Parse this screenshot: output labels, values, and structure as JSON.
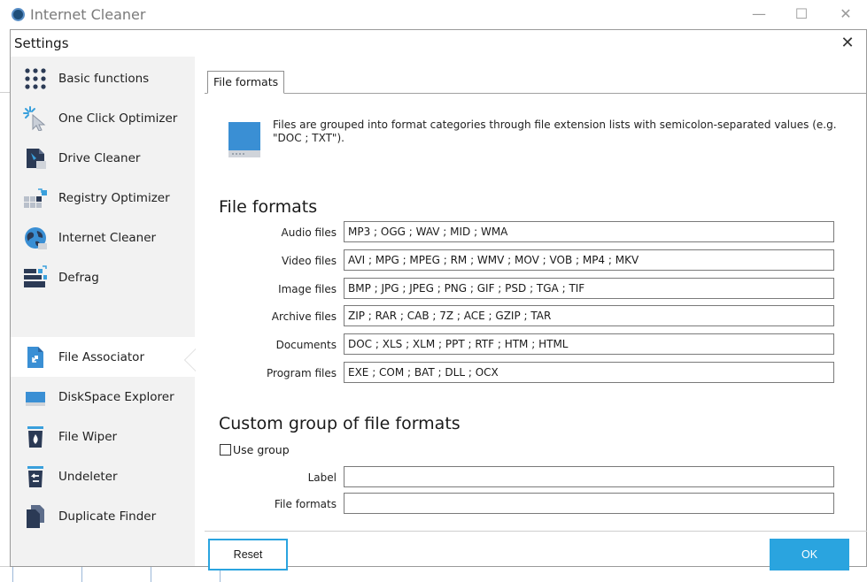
{
  "outer_window": {
    "title": "Internet Cleaner",
    "minimize": "—",
    "maximize": "☐",
    "close": "✕"
  },
  "dialog": {
    "title": "Settings",
    "close": "✕"
  },
  "sidebar": {
    "items": [
      {
        "label": "Basic functions",
        "icon": "grid-dots-icon"
      },
      {
        "label": "One Click Optimizer",
        "icon": "cursor-sparkle-icon"
      },
      {
        "label": "Drive Cleaner",
        "icon": "drive-cleaner-icon"
      },
      {
        "label": "Registry Optimizer",
        "icon": "registry-blocks-icon"
      },
      {
        "label": "Internet Cleaner",
        "icon": "globe-icon"
      },
      {
        "label": "Defrag",
        "icon": "defrag-blocks-icon"
      },
      {
        "label": "File Associator",
        "icon": "file-associator-icon"
      },
      {
        "label": "DiskSpace Explorer",
        "icon": "disk-icon"
      },
      {
        "label": "File Wiper",
        "icon": "trash-flame-icon"
      },
      {
        "label": "Undeleter",
        "icon": "trash-restore-icon"
      },
      {
        "label": "Duplicate Finder",
        "icon": "duplicate-files-icon"
      }
    ],
    "active_index": 6
  },
  "tab": {
    "label": "File formats"
  },
  "info": {
    "text": "Files are grouped into format categories through file extension lists with semicolon-separated values (e.g. \"DOC ; TXT\")."
  },
  "file_formats": {
    "heading": "File formats",
    "rows": [
      {
        "label": "Audio files",
        "value": "MP3 ; OGG ; WAV ; MID ; WMA"
      },
      {
        "label": "Video files",
        "value": "AVI ; MPG ; MPEG ; RM ; WMV ; MOV ; VOB ; MP4 ; MKV"
      },
      {
        "label": "Image files",
        "value": "BMP ; JPG ; JPEG ; PNG ; GIF ; PSD ; TGA ; TIF"
      },
      {
        "label": "Archive files",
        "value": "ZIP ; RAR ; CAB ; 7Z ; ACE ; GZIP ; TAR"
      },
      {
        "label": "Documents",
        "value": "DOC ; XLS ; XLM ; PPT ; RTF ; HTM ; HTML"
      },
      {
        "label": "Program files",
        "value": "EXE ; COM ; BAT ; DLL ; OCX"
      }
    ]
  },
  "custom_group": {
    "heading": "Custom group of file formats",
    "use_group_label": "Use group",
    "use_group_checked": false,
    "label_field": {
      "label": "Label",
      "value": ""
    },
    "formats_field": {
      "label": "File formats",
      "value": ""
    }
  },
  "footer": {
    "reset_label": "Reset",
    "ok_label": "OK"
  },
  "colors": {
    "accent": "#2aa4df",
    "sidebar_bg": "#f2f2f2"
  }
}
